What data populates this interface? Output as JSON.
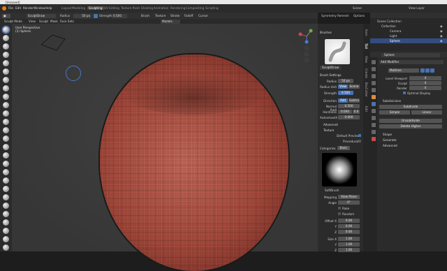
{
  "app": {
    "title": "[Unsaved]"
  },
  "menus": [
    "File",
    "Edit",
    "Render",
    "Window",
    "Help"
  ],
  "workspaces": [
    "Layout",
    "Modeling",
    "Sculpting",
    "UV Editing",
    "Texture Paint",
    "Shading",
    "Animation",
    "Rendering",
    "Compositing",
    "Scripting"
  ],
  "active_workspace": "Sculpting",
  "scene_label": "Scene",
  "view_layer": "View Layer",
  "tool_header": {
    "brush_name": "SculptDraw",
    "radius_label": "Radius",
    "radius_value": "50 px",
    "strength_label": "Strength",
    "strength_value": "0.500",
    "brush_menu": "Brush",
    "texture_menu": "Texture",
    "stroke_menu": "Stroke",
    "falloff_menu": "Falloff",
    "cursor_menu": "Cursor",
    "symmetry": "Symmetry",
    "remesh": "Remesh",
    "options": "Options"
  },
  "header2": {
    "mode": "Sculpt Mode",
    "view": "View",
    "sculpt": "Sculpt",
    "mask": "Mask",
    "face_sets": "Face Sets"
  },
  "viewport": {
    "view_name": "User Perspective",
    "object_name": "(1) Sphere",
    "shading_label": "Models"
  },
  "brushes_panel": {
    "title": "Brushes",
    "brush_name": "SculptDraw",
    "brush_settings": "Brush Settings",
    "radius_label": "Radius",
    "radius_value": "50 px",
    "radius_unit_view": "View",
    "radius_unit_scene": "Scene",
    "strength_label": "Strength",
    "strength_value": "0.500",
    "direction_label": "Direction",
    "direction_add": "Add",
    "direction_sub": "Subtra",
    "normal_radius_label": "Normal Radi",
    "normal_radius_value": "0.500",
    "hardness_label": "Hardness",
    "hardness_value": "0.000",
    "hardness_value2": "0.6",
    "autosmooth_label": "Autosmooth",
    "autosmooth_value": "0.000",
    "advanced": "Advanced",
    "texture": "Texture",
    "default_preview": "Default Preview",
    "procedural": "Procedural",
    "categories": "Categories",
    "basic": "Basic",
    "texture_name": "SoftBrush",
    "mapping_label": "Mapping",
    "mapping_value": "View Plane",
    "angle_label": "Angle",
    "angle_value": "0°",
    "rake": "Rake",
    "random": "Random",
    "offset_x_label": "Offset X",
    "offset_x": "0.00",
    "offset_y_label": "Y",
    "offset_y": "0.00",
    "offset_z_label": "Z",
    "offset_z": "0.00",
    "size_x_label": "Size X",
    "size_x": "1.00",
    "size_y_label": "Y",
    "size_y": "1.00",
    "size_z_label": "Z",
    "size_z": "1.00"
  },
  "side_tabs": [
    "Item",
    "Tool",
    "View",
    "Create",
    "BoxCutter",
    "Edit"
  ],
  "outliner": {
    "header": "Scene Collection",
    "items": [
      "Collection",
      "Camera",
      "Light",
      "Sphere"
    ]
  },
  "modifier": {
    "object_name": "Sphere",
    "add_modifier": "Add Modifier",
    "modifier_name": "Multires",
    "level_viewport_label": "Level Viewport",
    "level_viewport_value": "4",
    "sculpt_label": "Sculpt",
    "sculpt_value": "4",
    "render_label": "Render",
    "render_value": "4",
    "optimal_display": "Optimal Display",
    "subdivisions": "Subdivisions",
    "subdivide": "Subdivide",
    "simple": "Simple",
    "linear": "Linear",
    "unsubdivide": "Unsubdivide",
    "delete_higher": "Delete Higher",
    "shape": "Shape",
    "generate": "Generate",
    "advanced": "Advanced"
  },
  "colors": {
    "accent": "#4772b3",
    "sculpt_material": "#a84b3d",
    "panel_bg": "#2b2b2b"
  }
}
